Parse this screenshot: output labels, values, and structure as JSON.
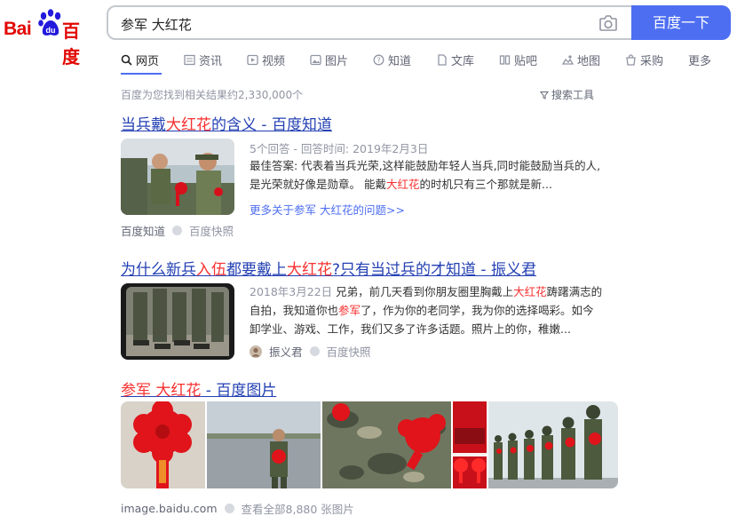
{
  "logo": {
    "text_bai": "Bai",
    "text_zh": "百度"
  },
  "search": {
    "query": "参军 大红花",
    "button_label": "百度一下"
  },
  "tabs": [
    {
      "label": "网页",
      "icon": "search-icon"
    },
    {
      "label": "资讯",
      "icon": "news-icon"
    },
    {
      "label": "视频",
      "icon": "video-icon"
    },
    {
      "label": "图片",
      "icon": "image-icon"
    },
    {
      "label": "知道",
      "icon": "question-icon"
    },
    {
      "label": "文库",
      "icon": "doc-icon"
    },
    {
      "label": "贴吧",
      "icon": "tieba-icon"
    },
    {
      "label": "地图",
      "icon": "map-icon"
    },
    {
      "label": "采购",
      "icon": "shop-icon"
    },
    {
      "label": "更多",
      "icon": ""
    }
  ],
  "result_count": "百度为您找到相关结果约2,330,000个",
  "search_tools": "搜索工具",
  "results": [
    {
      "title_pre": "当兵戴",
      "title_hl": "大红花",
      "title_post": "的含义 - 百度知道",
      "meta": "5个回答 - 回答时间: 2019年2月3日",
      "abstract_1": "最佳答案: 代表着当兵光荣,这样能鼓励年轻人当兵,同时能鼓励当兵的人,",
      "abstract_2_pre": "是光荣就好像是勋章。 能戴",
      "abstract_2_hl": "大红花",
      "abstract_2_post": "的时机只有三个那就是新...",
      "more_link": "更多关于参军 大红花的问题>>",
      "source": "百度知道",
      "snapshot": "百度快照"
    },
    {
      "title_a": "为什么新兵",
      "title_hl1": "入伍",
      "title_b": "都要戴上",
      "title_hl2": "大红花",
      "title_c": "?只有当过兵的才知道 - 振义君",
      "date": "2018年3月22日",
      "line1_pre": " 兄弟，前几天看到你朋友圈里胸戴上",
      "line1_hl": "大红花",
      "line1_post": "踌躇满志的",
      "line2_pre": "自拍，我知道你也",
      "line2_hl": "参军",
      "line2_post": "了，作为你的老同学，我为你的选择喝彩。如今",
      "line3": "卸学业、游戏、工作，我们又多了许多话题。照片上的你，稚嫩...",
      "source": "振义君",
      "snapshot": "百度快照"
    },
    {
      "title_hl": "参军 大红花",
      "title_post": " - 百度图片",
      "source": "image.baidu.com",
      "view_all": "查看全部8,880 张图片"
    }
  ],
  "colors": {
    "accent": "#4e6ef2",
    "link": "#2440b3",
    "highlight": "#f73131",
    "brand_red": "#e10602"
  }
}
